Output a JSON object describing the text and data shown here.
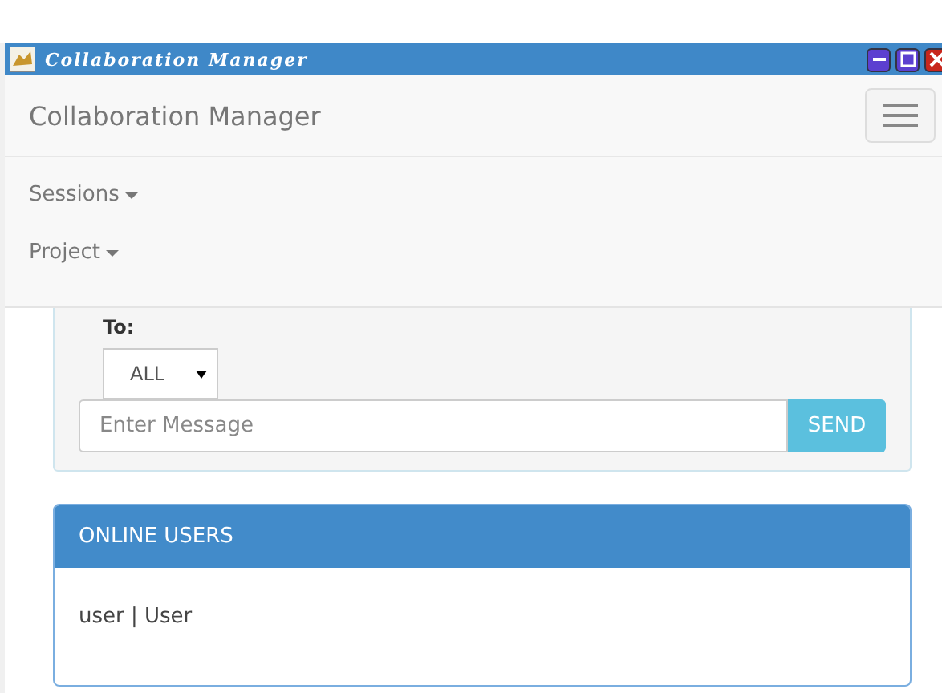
{
  "window": {
    "title": "Collaboration Manager"
  },
  "navbar": {
    "brand": "Collaboration Manager",
    "menu_items": [
      {
        "label": "Sessions"
      },
      {
        "label": "Project"
      }
    ]
  },
  "message_panel": {
    "to_label": "To:",
    "recipient": "ALL",
    "message": {
      "placeholder": "Enter Message"
    },
    "send_button": "SEND"
  },
  "online_users": {
    "title": "ONLINE USERS",
    "users": [
      "user | User"
    ]
  }
}
